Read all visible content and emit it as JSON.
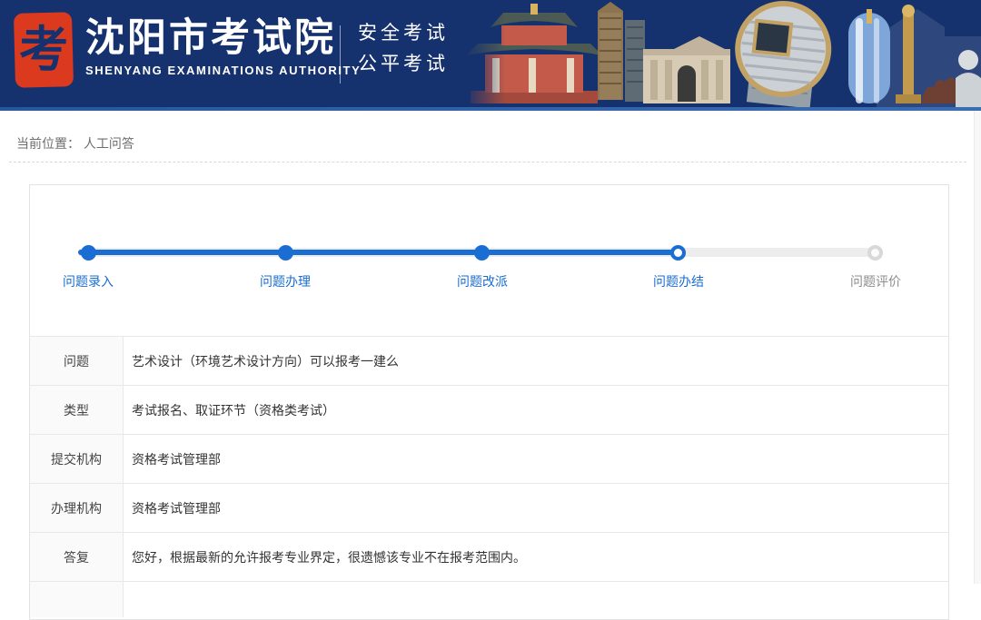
{
  "colors": {
    "header_bg": "#16326e",
    "header_strip_blue": "#2e61a8",
    "seal_red": "#dc3a1e",
    "primary_blue": "#1a6dd2",
    "track_gray": "#ededed",
    "pending_gray": "#d8d8d8",
    "row_border": "#e8e8e8",
    "label_column_bg": "#fafafa",
    "text_dark": "#333333",
    "text_gray": "#8c8c8c"
  },
  "header": {
    "logo_icon": "red-seal-kao-icon",
    "seal_char": "考",
    "title": "沈阳市考试院",
    "subtitle": "SHENYANG EXAMINATIONS AUTHORITY",
    "slogan_line1": "安全考试",
    "slogan_line2": "公平考试",
    "illustration": "shenyang-landmarks-collage"
  },
  "breadcrumb": {
    "prefix": "当前位置：",
    "current": "人工问答"
  },
  "stepper": {
    "steps": [
      {
        "label": "问题录入",
        "state": "done"
      },
      {
        "label": "问题办理",
        "state": "done"
      },
      {
        "label": "问题改派",
        "state": "done"
      },
      {
        "label": "问题办结",
        "state": "current"
      },
      {
        "label": "问题评价",
        "state": "pending"
      }
    ]
  },
  "qa": {
    "rows": [
      {
        "label": "问题",
        "value": "艺术设计（环境艺术设计方向）可以报考一建么"
      },
      {
        "label": "类型",
        "value": "考试报名、取证环节（资格类考试）"
      },
      {
        "label": "提交机构",
        "value": "资格考试管理部"
      },
      {
        "label": "办理机构",
        "value": "资格考试管理部"
      },
      {
        "label": "答复",
        "value": "您好，根据最新的允许报考专业界定，很遗憾该专业不在报考范围内。"
      }
    ]
  }
}
